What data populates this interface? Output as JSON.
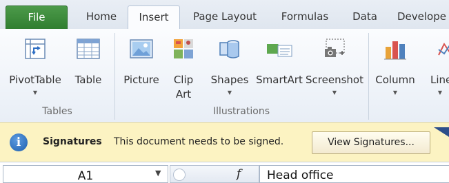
{
  "tabs": {
    "file": "File",
    "home": "Home",
    "insert": "Insert",
    "page_layout": "Page Layout",
    "formulas": "Formulas",
    "data": "Data",
    "developer": "Develope"
  },
  "ribbon": {
    "groups": {
      "tables": "Tables",
      "illustrations": "Illustrations"
    },
    "buttons": {
      "pivottable": "PivotTable",
      "table": "Table",
      "picture": "Picture",
      "clipart_line1": "Clip",
      "clipart_line2": "Art",
      "shapes": "Shapes",
      "smartart": "SmartArt",
      "screenshot": "Screenshot",
      "column": "Column",
      "line": "Line"
    }
  },
  "signatures_bar": {
    "title": "Signatures",
    "message": "This document needs to be signed.",
    "button": "View Signatures..."
  },
  "formula_bar": {
    "name_box": "A1",
    "fx_symbol": "f",
    "value": "Head office"
  },
  "colors": {
    "file_tab": "#3a8a38",
    "message_bar": "#fcf3c2",
    "info_icon": "#2a6cc0"
  }
}
